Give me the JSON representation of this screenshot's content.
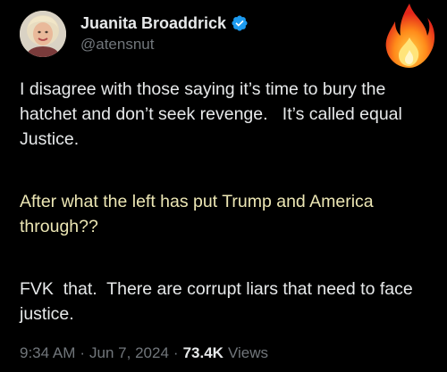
{
  "author": {
    "display_name": "Juanita Broaddrick",
    "handle": "@atensnut",
    "verified": true
  },
  "tweet": {
    "paragraphs": [
      "I disagree with those saying it’s time to bury the hatchet and don’t seek revenge.   It’s called equal Justice.",
      "After what the left has put Trump and America through??",
      "FVK  that.  There are corrupt liars that need to face justice."
    ]
  },
  "meta": {
    "time": "9:34 AM",
    "separator": "·",
    "date": "Jun 7, 2024",
    "views_count": "73.4K",
    "views_label": "Views"
  },
  "icons": {
    "verified": "verified-badge-icon",
    "fire": "fire-emoji-icon"
  },
  "colors": {
    "background": "#000000",
    "text": "#e7e9ea",
    "secondary": "#71767b",
    "verified": "#1d9bf0",
    "highlight_text": "#ece6b4"
  }
}
